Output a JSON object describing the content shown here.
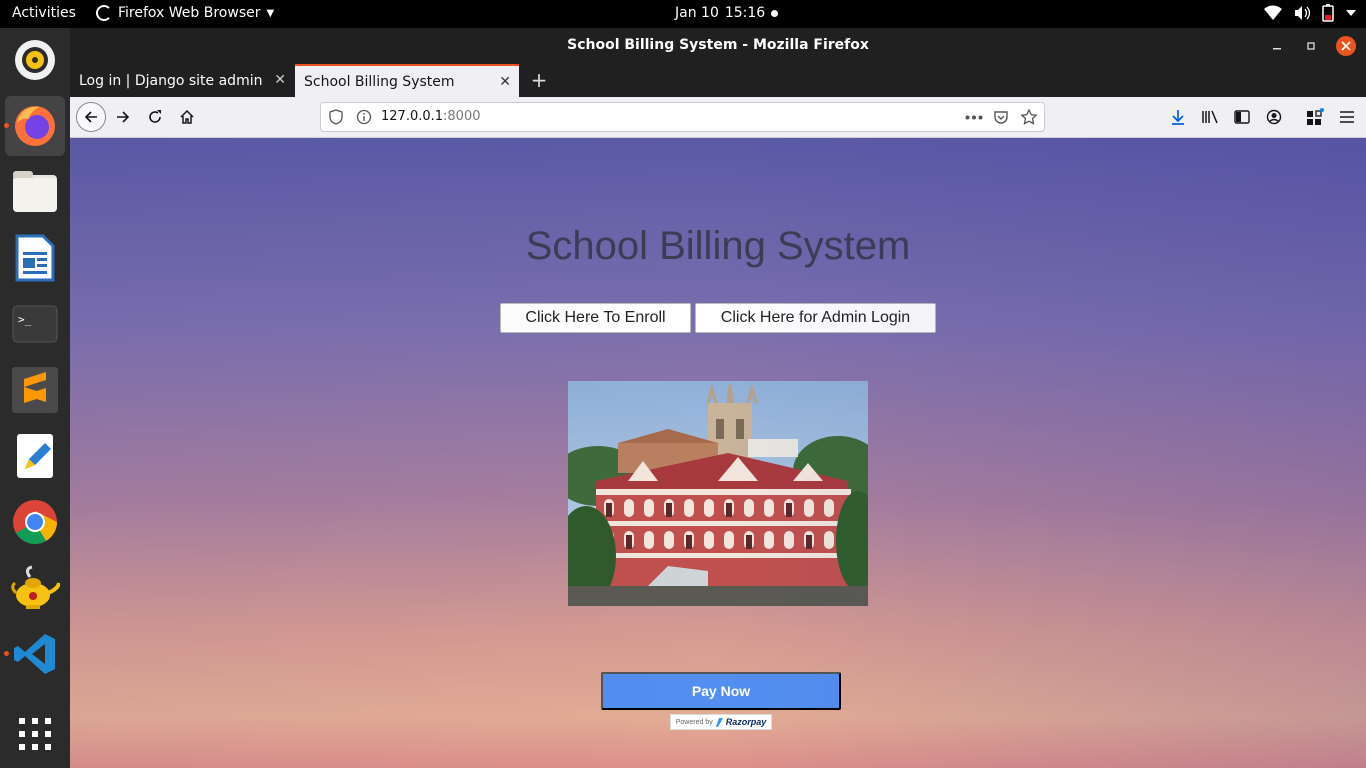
{
  "topbar": {
    "activities": "Activities",
    "app_name": "Firefox Web Browser",
    "date": "Jan 10",
    "time": "15:16"
  },
  "dock": {
    "items": [
      "rhythmbox-icon",
      "firefox-icon",
      "files-icon",
      "libreoffice-writer-icon",
      "terminal-icon",
      "sublime-text-icon",
      "text-editor-icon",
      "chrome-icon",
      "genie-icon",
      "vscode-icon",
      "show-apps-icon"
    ]
  },
  "window": {
    "title": "School Billing System - Mozilla Firefox"
  },
  "tabs": [
    {
      "label": "Log in | Django site admin",
      "selected": false
    },
    {
      "label": "School Billing System",
      "selected": true
    }
  ],
  "navbar": {
    "url_host": "127.0.0.1",
    "url_port": ":8000"
  },
  "page": {
    "title": "School Billing System",
    "enroll_button": "Click Here To Enroll",
    "admin_button": "Click Here for Admin Login",
    "pay_button": "Pay Now",
    "powered_by": "Powered by",
    "razorpay": "Razorpay"
  },
  "colors": {
    "accent": "#e95420",
    "pay_button": "#528ff0"
  }
}
